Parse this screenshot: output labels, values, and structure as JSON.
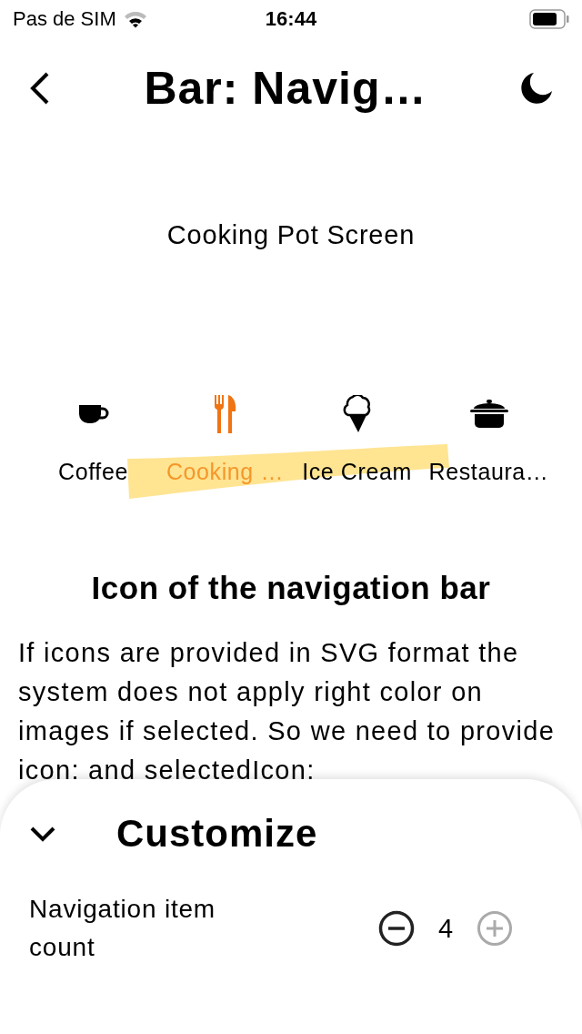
{
  "status_bar": {
    "carrier": "Pas de SIM",
    "time": "16:44"
  },
  "app_bar": {
    "title": "Bar: Navig…"
  },
  "content": {
    "screen_label": "Cooking Pot Screen"
  },
  "navigation_bar": {
    "items": [
      {
        "kind": "coffee",
        "label": "Coffee",
        "selected": false
      },
      {
        "kind": "cutlery",
        "label": "Cooking …",
        "selected": true
      },
      {
        "kind": "icecream",
        "label": "Ice Cream",
        "selected": false
      },
      {
        "kind": "pot",
        "label": "Restaura…",
        "selected": false
      }
    ]
  },
  "section": {
    "heading": "Icon of the navigation bar",
    "paragraph": "If icons are provided in SVG format the system does not apply right color on images if selected. So we need to provide icon: and selectedIcon:"
  },
  "customize": {
    "title": "Customize",
    "expanded": true,
    "stepper": {
      "label": "Navigation item count",
      "value": "4",
      "decrement_disabled": false,
      "increment_disabled": true
    }
  }
}
